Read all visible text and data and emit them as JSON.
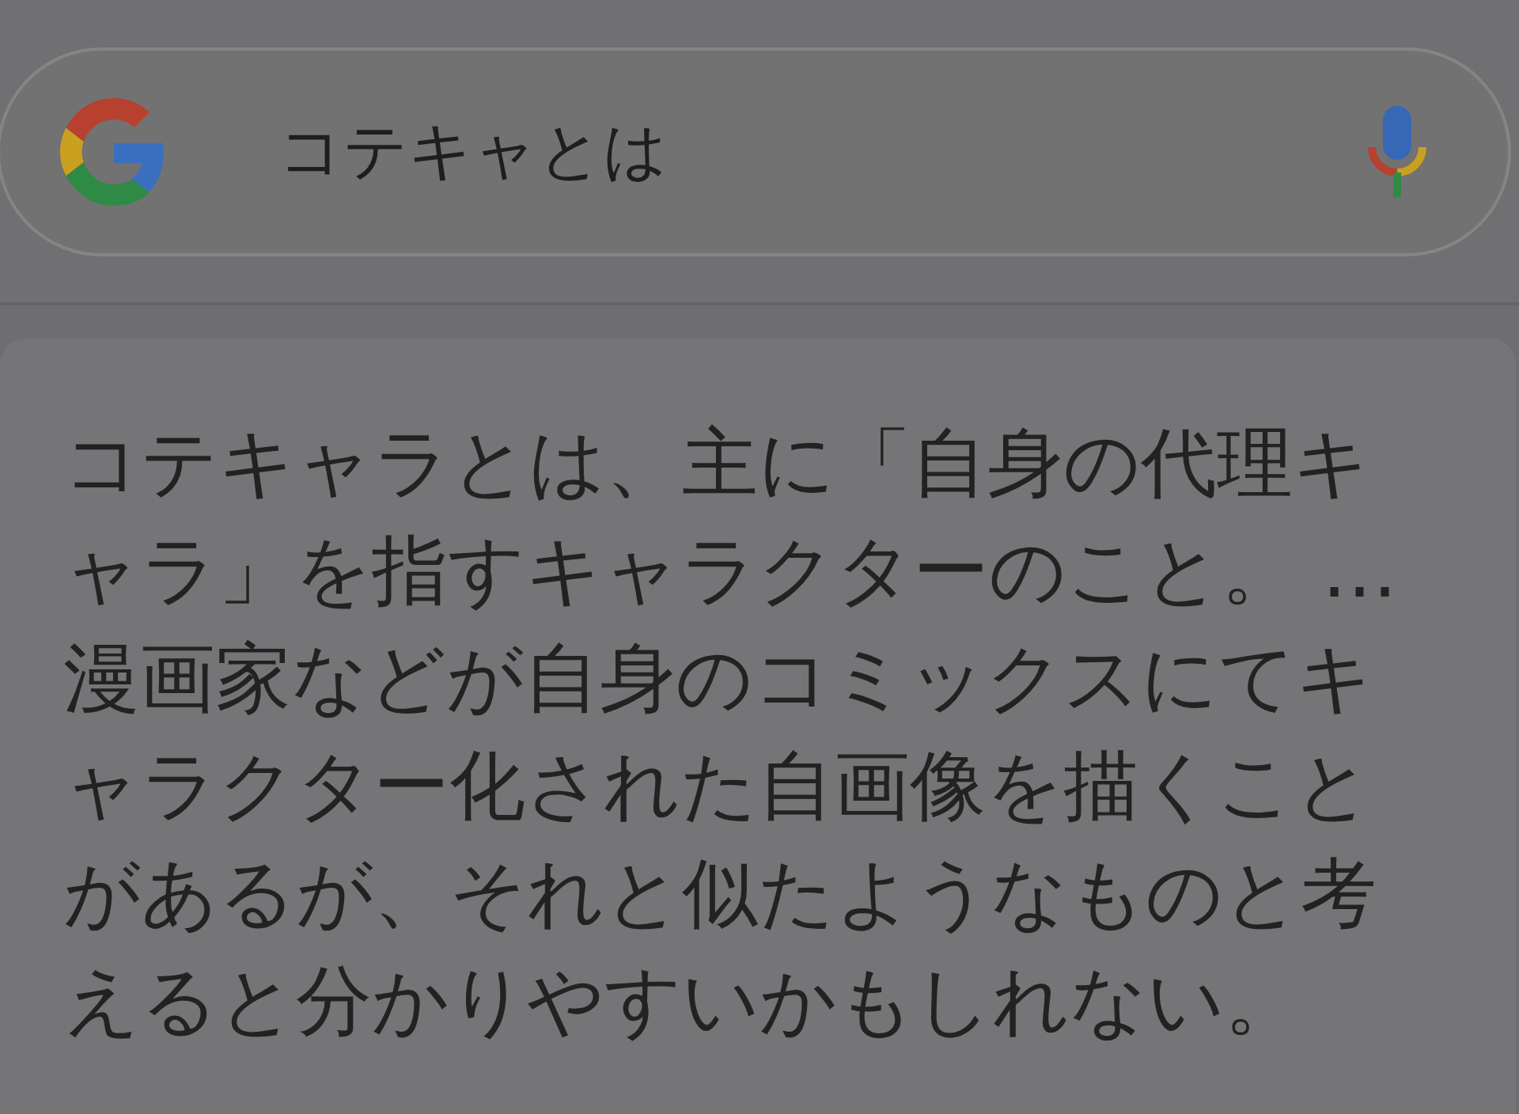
{
  "search": {
    "value": "コテキャとは"
  },
  "snippet": {
    "text": "コテキャラとは、主に「自身の代理キャラ」を指すキャラクターのこと。 …漫画家などが自身のコミックスにてキャラクター化された自画像を描くことがあるが、それと似たようなものと考えると分かりやすいかもしれない。"
  }
}
